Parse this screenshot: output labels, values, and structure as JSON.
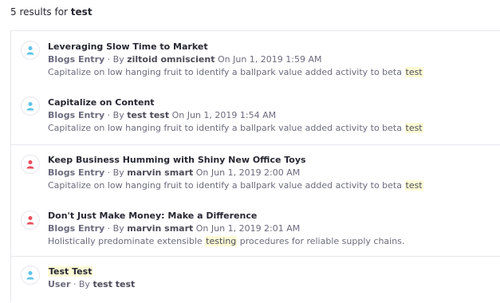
{
  "summary": {
    "prefix": "5 results for",
    "query": "test"
  },
  "colors": {
    "user_icon": "#5ec3e8",
    "author_icon": "#e8505b",
    "highlight": "#fdfbd6"
  },
  "results": [
    {
      "icon": "user-icon",
      "title": "Leveraging Slow Time to Market",
      "type": "Blogs Entry",
      "by": "By",
      "author": "ziltoid omniscient",
      "date": "On Jun 1, 2019 1:59 AM",
      "snippet_before": "Capitalize on low hanging fruit to identify a ballpark value added activity to beta",
      "snippet_match": "test",
      "snippet_after": ""
    },
    {
      "icon": "user-icon",
      "title": "Capitalize on Content",
      "type": "Blogs Entry",
      "by": "By",
      "author": "test test",
      "date": "On Jun 1, 2019 1:54 AM",
      "snippet_before": "Capitalize on low hanging fruit to identify a ballpark value added activity to beta",
      "snippet_match": "test",
      "snippet_after": ""
    },
    {
      "icon": "user-icon",
      "title": "Keep Business Humming with Shiny New Office Toys",
      "type": "Blogs Entry",
      "by": "By",
      "author": "marvin smart",
      "date": "On Jun 1, 2019 2:00 AM",
      "snippet_before": "Capitalize on low hanging fruit to identify a ballpark value added activity to beta",
      "snippet_match": "test",
      "snippet_after": ""
    },
    {
      "icon": "user-icon",
      "title": "Don't Just Make Money: Make a Difference",
      "type": "Blogs Entry",
      "by": "By",
      "author": "marvin smart",
      "date": "On Jun 1, 2019 2:01 AM",
      "snippet_before": "Holistically predominate extensible",
      "snippet_match": "testing",
      "snippet_after": "procedures for reliable supply chains."
    },
    {
      "icon": "user-icon",
      "title": "Test Test",
      "type": "User",
      "by": "By",
      "author": "test test"
    }
  ]
}
